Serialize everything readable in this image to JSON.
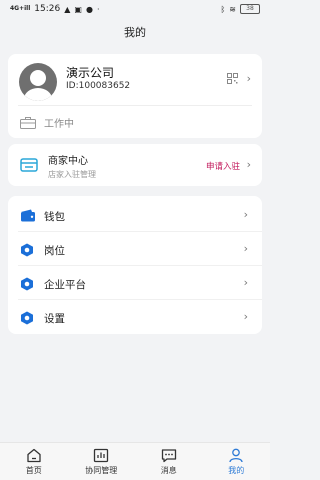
{
  "status_bar": {
    "signal": "4G+ill",
    "time": "15:26",
    "battery": "38"
  },
  "page_title": "我的",
  "profile": {
    "company_name": "演示公司",
    "user_id": "ID:100083652",
    "work_status": "工作中"
  },
  "merchant": {
    "title": "商家中心",
    "subtitle": "店家入驻管理",
    "apply_label": "申请入驻"
  },
  "menu": {
    "items": [
      {
        "label": "钱包",
        "icon": "wallet-icon"
      },
      {
        "label": "岗位",
        "icon": "hexagon-icon"
      },
      {
        "label": "企业平台",
        "icon": "hexagon-icon"
      },
      {
        "label": "设置",
        "icon": "hexagon-icon"
      }
    ]
  },
  "tabs": [
    {
      "label": "首页",
      "icon": "home-icon"
    },
    {
      "label": "协同管理",
      "icon": "chart-icon"
    },
    {
      "label": "消息",
      "icon": "message-icon"
    },
    {
      "label": "我的",
      "icon": "person-icon",
      "active": true
    }
  ],
  "colors": {
    "accent": "#2e7bd6",
    "apply": "#c2185b",
    "background": "#f2f3f5"
  }
}
